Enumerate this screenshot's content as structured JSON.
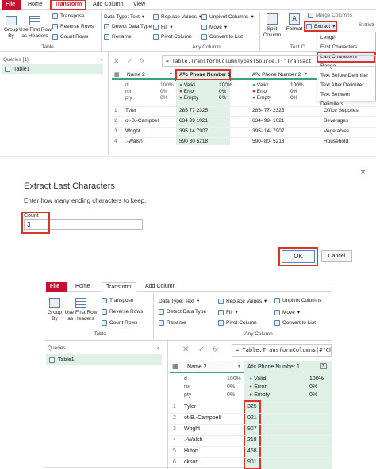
{
  "top": {
    "tabs": [
      "File",
      "Home",
      "Transform",
      "Add Column",
      "View"
    ],
    "buttons": {
      "group_by": "Group\nBy",
      "first_row": "Use First Row\nas Headers",
      "transpose": "Transpose",
      "reverse": "Reverse Rows",
      "count": "Count Rows",
      "datatype": "Data Type: Text",
      "detect": "Detect Data Type",
      "rename": "Rename",
      "replace": "Replace Values",
      "fill": "Fill",
      "pivot": "Pivot Column",
      "unpivot": "Unpivot Columns",
      "move": "Move",
      "convert": "Convert to List",
      "split": "Split\nColumn",
      "format": "Format",
      "merge": "Merge Columns",
      "extract": "Extract",
      "stat": "Statisti"
    },
    "groups": {
      "table": "Table",
      "anycol": "Any Column",
      "textcol": "Text C"
    },
    "extract_menu": [
      "Length",
      "First Characters",
      "Last Characters",
      "Range",
      "Text Before Delimiter",
      "Text After Delimiter",
      "Text Between Delimiters"
    ],
    "queries_header": "Queries [1]",
    "query_item": "Table1",
    "formula": "= Table.TransformColumnTypes(Source,{{\"Transact",
    "col_name2": "Name 2",
    "col_phone1": "Phone Number 1",
    "col_phone2": "Phone Number 2",
    "stats_left": [
      [
        "d",
        "100%"
      ],
      [
        "ror",
        "0%"
      ],
      [
        "pty",
        "0%"
      ]
    ],
    "stats_mid": [
      "Valid",
      "Error",
      "Empty"
    ],
    "stats_mid_vals": [
      "100%",
      "0%",
      "0%"
    ],
    "stats_right": [
      "Valid",
      "Error",
      "Empty"
    ],
    "stats_right_vals": [
      "100%",
      "0%",
      "0%"
    ],
    "rows": [
      [
        "1",
        "Tyler",
        "285 77 2325",
        "285- 77- 2325",
        "Office Supplies"
      ],
      [
        "2",
        "ot-B.-Campbell",
        "634 99 1021",
        "634- 99- 1021",
        "Beverages"
      ],
      [
        "3",
        "Wright",
        "395 14 7907",
        "395- 14- 7907",
        "Vegetables"
      ],
      [
        "4",
        ".-Walsh",
        "590 80 5218",
        "590- 80- 5218",
        "Household"
      ]
    ]
  },
  "dialog": {
    "title": "Extract Last Characters",
    "desc": "Enter how many ending characters to keep.",
    "count_label": "Count",
    "count_value": "3",
    "ok": "OK",
    "cancel": "Cancel",
    "close": "×"
  },
  "bottom": {
    "tabs": [
      "File",
      "Home",
      "Transform",
      "Add Column"
    ],
    "buttons": {
      "group_by": "Group\nBy",
      "first_row": "Use First Row\nas Headers",
      "transpose": "Transpose",
      "reverse": "Reverse Rows",
      "count": "Count Rows",
      "datatype": "Data Type: Text",
      "detect": "Detect Data Type",
      "rename": "Rename",
      "replace": "Replace Values",
      "fill": "Fill",
      "pivot": "Pivot Column",
      "unpivot": "Unpivot Columns",
      "move": "Move",
      "convert": "Convert to List"
    },
    "groups": {
      "table": "Table",
      "anycol": "Any Column"
    },
    "queries_header": "Queries",
    "query_item": "Table1",
    "formula": "= Table.TransformColumns(#\"Ch",
    "col_name2": "Name 2",
    "col_phone1": "Phone Number 1",
    "stats_left": [
      [
        "d",
        "100%"
      ],
      [
        "ror",
        "0%"
      ],
      [
        "pty",
        "0%"
      ]
    ],
    "stats_mid": [
      "Valid",
      "Error",
      "Empty"
    ],
    "stats_mid_vals": [
      "100%",
      "0%",
      "0%"
    ],
    "rows": [
      [
        "1",
        "Tyler",
        "325"
      ],
      [
        "2",
        "ot-B.-Campbell",
        "021"
      ],
      [
        "3",
        "Wright",
        "907"
      ],
      [
        "4",
        ".-Walsh",
        "218"
      ],
      [
        "5",
        "Hilton",
        "468"
      ],
      [
        "6",
        "ckson",
        "901"
      ]
    ]
  },
  "colors": {
    "file_red": "#c8102e",
    "highlight_red": "#d9342b",
    "green": "#dff1e6",
    "teal": "#3aa17e"
  }
}
